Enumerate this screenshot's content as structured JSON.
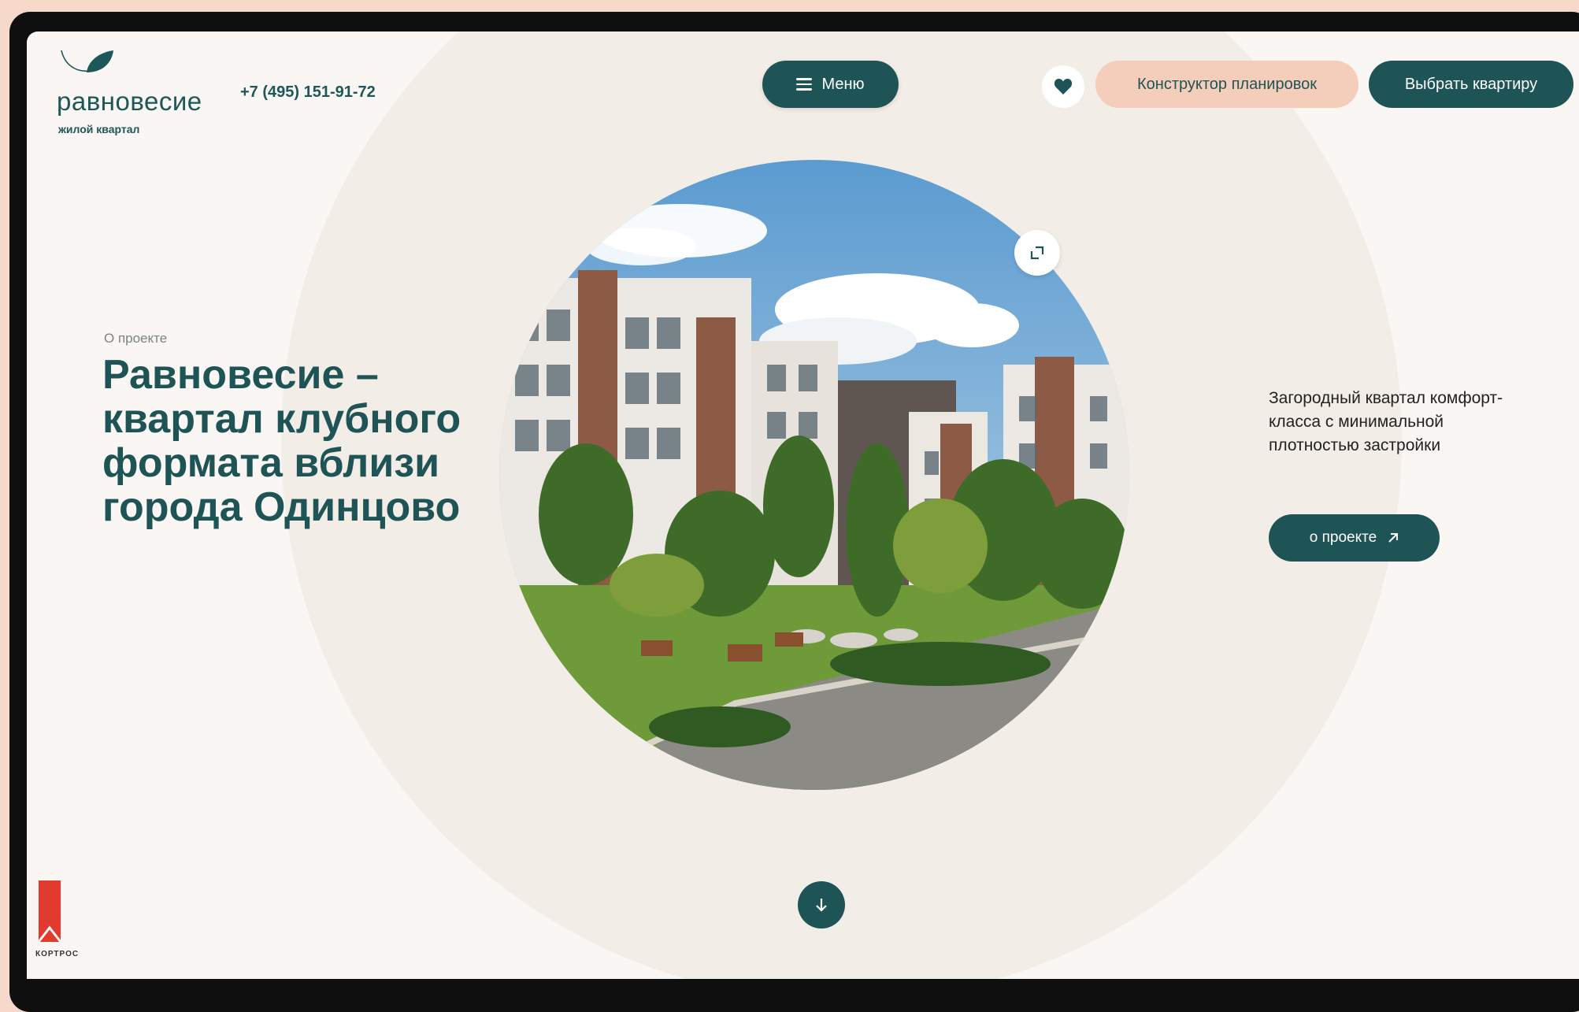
{
  "brand": {
    "name": "равновесие",
    "subtitle": "жилой квартал",
    "accent_color": "#1f5456",
    "peach_color": "#f4cdbb"
  },
  "header": {
    "phone": "+7 (495) 151-91-72",
    "menu_label": "Меню",
    "menu_icon": "hamburger-icon",
    "favorites_icon": "heart-icon",
    "constructor_label": "Конструктор планировок",
    "choose_label": "Выбрать квартиру"
  },
  "hero": {
    "eyebrow": "О проекте",
    "headline": "Равновесие – квартал клубного формата вблизи города Одинцово",
    "image_icon": "expand-icon",
    "description": "Загородный квартал комфорт-класса с минимальной плотностью застройки",
    "about_label": "о проекте",
    "about_icon": "arrow-up-right-icon",
    "scroll_icon": "arrow-down-icon"
  },
  "developer": {
    "name": "КОРТРОС"
  }
}
